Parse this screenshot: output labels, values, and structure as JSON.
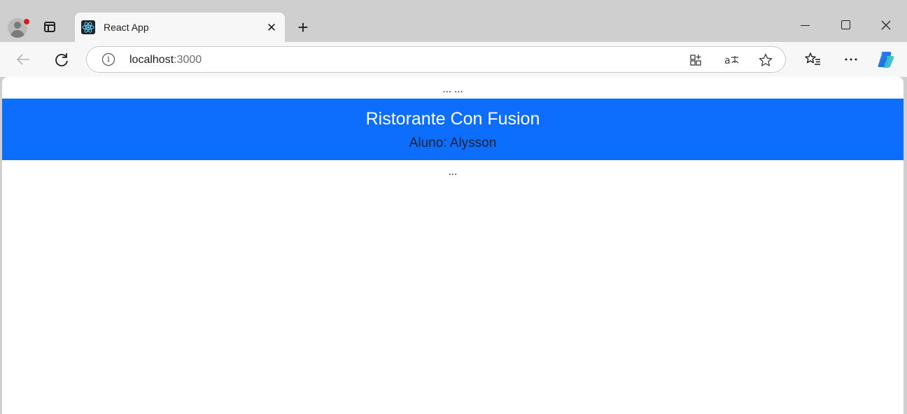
{
  "browser": {
    "tab": {
      "title": "React App",
      "close_glyph": "✕"
    },
    "new_tab_glyph": "+",
    "address": {
      "host": "localhost",
      "port": ":3000"
    },
    "icons": [
      "profile-icon",
      "tab-actions-icon",
      "react-favicon",
      "back-icon",
      "reload-icon",
      "site-info-icon",
      "app-available-icon",
      "read-aloud-icon",
      "favorite-star-icon",
      "favorites-icon",
      "menu-icon",
      "copilot-icon"
    ],
    "colors": {
      "frame": "#cfcfcf",
      "toolbar": "#f7f7f7",
      "accent": "#0d6efd"
    }
  },
  "page": {
    "dots_top": "... ...",
    "header": {
      "title": "Ristorante Con Fusion",
      "subtitle": "Aluno: Alysson"
    },
    "dots_bottom": "..."
  }
}
